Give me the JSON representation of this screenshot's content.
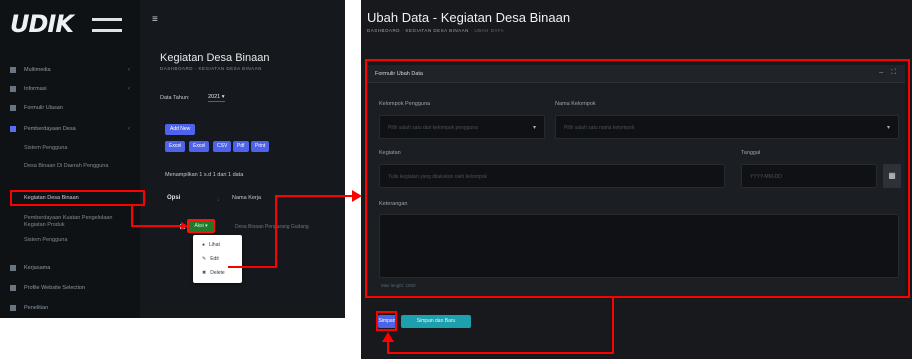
{
  "left": {
    "logo_text": "UDIK",
    "nav": [
      {
        "label": "Multimedia",
        "chevron": "‹"
      },
      {
        "label": "Informasi",
        "chevron": "‹"
      },
      {
        "label": "Formulir Ulasan",
        "chevron": ""
      },
      {
        "label": "Pemberdayaan Desa",
        "chevron": "‹"
      },
      {
        "label": "Sistem Pengguna",
        "chevron": ""
      }
    ],
    "sub_items": [
      "Desa Binaan Di Daerah Pengguna",
      "Kegiatan Desa Binaan",
      "Pemberdayaan Kuatan Pengelolaan Kegiatan Produk",
      "Sistem Pengguna"
    ],
    "bottom_nav": [
      {
        "label": "Kerjasama"
      },
      {
        "label": "Profile Website Selection"
      },
      {
        "label": "Penelitian"
      }
    ],
    "menu_icon": "hamburger-icon",
    "page_title": "Kegiatan Desa Binaan",
    "breadcrumb": "DASHBOARD · KEGIATAN DESA BINAAN",
    "data_tahun_label": "Data Tahun:",
    "data_tahun_value": "2021 ▾",
    "btn_add": "Add New",
    "export_buttons": [
      "Excel",
      "Excel",
      "CSV",
      "Pdf",
      "Print"
    ],
    "showing_text": "Menampilkan 1 s.d 1 dari 1 data",
    "col_opsi": "Opsi",
    "col_sep": "↓",
    "col_nama": "Nama Kerja",
    "aksi_label": "Aksi ▾",
    "row_text": "Desa Binaan Pengarang Gudang",
    "dropdown": [
      {
        "icon": "eye-icon",
        "glyph": "●",
        "label": "Lihat"
      },
      {
        "icon": "pencil-icon",
        "glyph": "✎",
        "label": "Edit"
      },
      {
        "icon": "trash-icon",
        "glyph": "✖",
        "label": "Delete"
      }
    ]
  },
  "right": {
    "title": "Ubah Data - Kegiatan Desa Binaan",
    "breadcrumb_dark": "DASHBOARD · KEGIATAN DESA BINAAN",
    "breadcrumb_light": "· UBAH DATA",
    "panel_title": "Formulir Ubah Data",
    "panel_controls": "– ⛶",
    "fields": {
      "kelompok_label": "Kelompok Pengguna",
      "kelompok_placeholder": "Pilih salah satu dari kelompok pengguna",
      "nama_label": "Nama Kelompok",
      "nama_placeholder": "Pilih salah satu nama kelompok",
      "kegiatan_label": "Kegiatan",
      "kegiatan_placeholder": "Tulis kegiatan yang dilakukan oleh kelompok",
      "tanggal_label": "Tanggal",
      "tanggal_placeholder": "YYYY-MM-DD",
      "keterangan_label": "Keterangan"
    },
    "hint": "Max length: 1000",
    "btn_simpan": "Simpan",
    "btn_simpan_baru": "Simpan dan Baru"
  },
  "colors": {
    "annotation": "#ff0000",
    "primary": "#4f63ea",
    "teal": "#1e9fae",
    "success": "#1f7a2b"
  }
}
